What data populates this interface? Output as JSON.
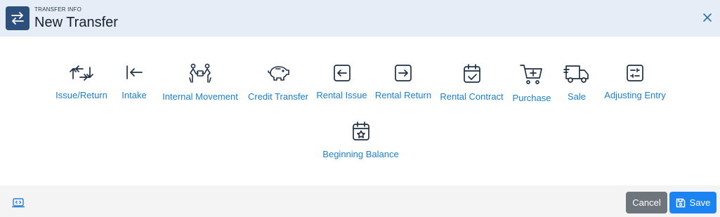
{
  "header": {
    "subtitle": "TRANSFER INFO",
    "title": "New Transfer",
    "icon": "transfer-arrows-icon",
    "close_icon": "close-icon"
  },
  "options": [
    {
      "label": "Issue/Return",
      "icon": "issue-return-icon"
    },
    {
      "label": "Intake",
      "icon": "intake-icon"
    },
    {
      "label": "Internal Movement",
      "icon": "internal-movement-icon"
    },
    {
      "label": "Credit Transfer",
      "icon": "piggy-bank-icon"
    },
    {
      "label": "Rental Issue",
      "icon": "rental-issue-icon"
    },
    {
      "label": "Rental Return",
      "icon": "rental-return-icon"
    },
    {
      "label": "Rental Contract",
      "icon": "calendar-check-icon"
    },
    {
      "label": "Purchase",
      "icon": "cart-plus-icon"
    },
    {
      "label": "Sale",
      "icon": "delivery-truck-icon"
    },
    {
      "label": "Adjusting Entry",
      "icon": "adjust-icon"
    },
    {
      "label": "Beginning Balance",
      "icon": "calendar-star-icon"
    }
  ],
  "footer": {
    "cancel_label": "Cancel",
    "save_label": "Save",
    "save_icon": "save-icon",
    "left_icon": "code-window-icon"
  },
  "colors": {
    "header_bg": "#e7edf6",
    "header_icon_bg": "#2c4f7c",
    "link": "#1a7fd1",
    "icon_stroke": "#1e3146",
    "cancel_bg": "#6e757c",
    "save_bg": "#1b84f2",
    "footer_bg": "#f4f4f5"
  }
}
